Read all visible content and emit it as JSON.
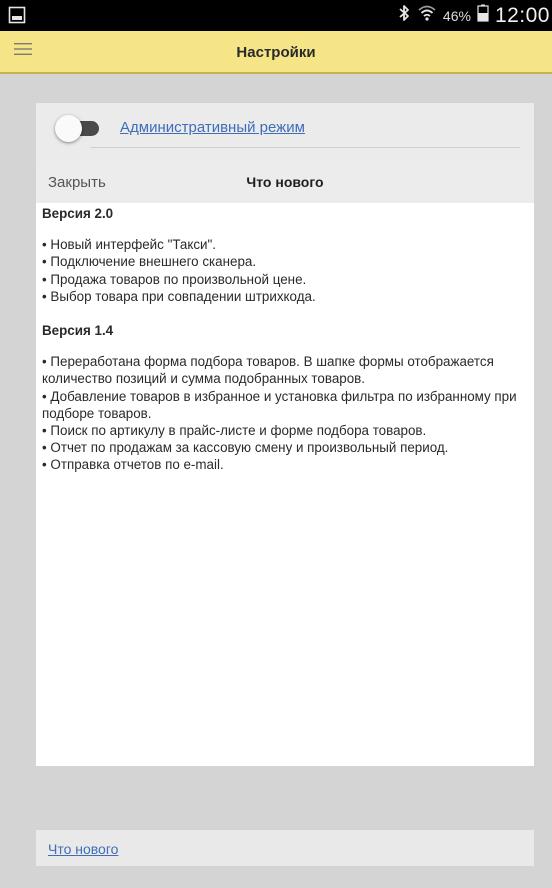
{
  "status_bar": {
    "left_icon": "screenshot-icon",
    "bluetooth_icon": "bluetooth-icon",
    "wifi_icon": "wifi-icon",
    "battery_icon": "battery-icon",
    "battery_text": "46%",
    "time": "12:00"
  },
  "app_bar": {
    "menu_icon": "hamburger-menu-icon",
    "title": "Настройки",
    "background": "#f5e587"
  },
  "settings": {
    "admin_mode_label": "Административный режим",
    "admin_mode_on": false
  },
  "whats_new": {
    "close_label": "Закрыть",
    "title": "Что нового",
    "versions": [
      {
        "title": "Версия 2.0",
        "items": [
          "• Новый интерфейс \"Такси\".",
          "• Подключение внешнего сканера.",
          "• Продажа товаров по произвольной цене.",
          "• Выбор товара при совпадении штрихкода."
        ]
      },
      {
        "title": "Версия 1.4",
        "items": [
          "• Переработана форма подбора товаров. В шапке формы отображается количество позиций и сумма подобранных товаров.",
          "• Добавление товаров в избранное и установка фильтра по избранному при подборе товаров.",
          "• Поиск по артикулу в прайс-листе и форме подбора товаров.",
          "• Отчет по продажам за кассовую смену и произвольный период.",
          "• Отправка отчетов по e-mail."
        ]
      }
    ]
  },
  "footer": {
    "whats_new_link": "Что нового"
  },
  "colors": {
    "link": "#3f6db7",
    "app_bar": "#f5e587",
    "background": "#d4d4d4"
  }
}
